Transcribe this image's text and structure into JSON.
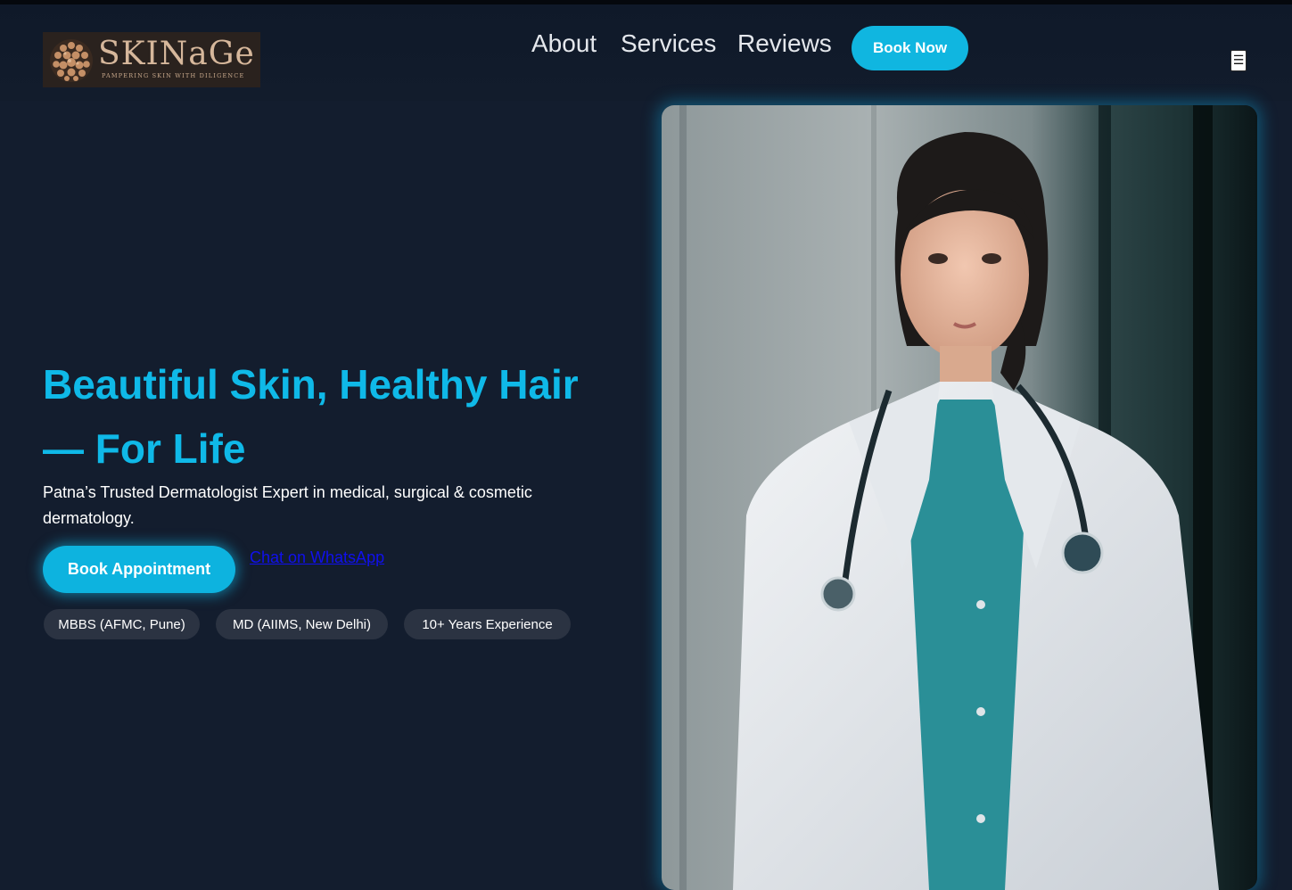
{
  "logo": {
    "name": "SKINaGe",
    "tagline": "PAMPERING SKIN WITH DILIGENCE"
  },
  "nav": {
    "about": "About",
    "services": "Services",
    "reviews": "Reviews",
    "book_now": "Book Now",
    "menu_icon": "☰"
  },
  "hero": {
    "title": "Beautiful Skin, Healthy Hair — For Life",
    "subtitle": "Patna’s Trusted Dermatologist Expert in medical, surgical & cosmetic dermatology.",
    "cta_primary": "Book Appointment",
    "cta_secondary": "Chat on WhatsApp",
    "badges": [
      "MBBS (AFMC, Pune)",
      "MD (AIIMS, New Delhi)",
      "10+ Years Experience"
    ]
  },
  "colors": {
    "background": "#131d2e",
    "accent": "#0fb9e8",
    "badge_bg": "#2b3342",
    "logo_bg": "#2a221e"
  },
  "icons": {
    "logo_mark": "sphere-mosaic-icon",
    "menu": "hamburger-menu-icon"
  }
}
